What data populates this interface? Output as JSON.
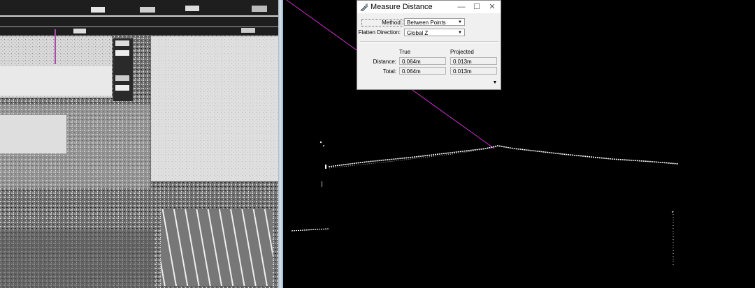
{
  "dialog": {
    "title": "Measure Distance",
    "method_label": "Method:",
    "method_value": "Between Points",
    "flatten_label": "Flatten Direction:",
    "flatten_value": "Global Z",
    "columns": {
      "true": "True",
      "projected": "Projected"
    },
    "distance_label": "Distance:",
    "total_label": "Total:",
    "distance": {
      "true": "0.064m",
      "projected": "0.013m"
    },
    "total": {
      "true": "0.064m",
      "projected": "0.013m"
    }
  },
  "icons": {
    "app": "measure-ruler-icon",
    "minimize": "minimize-icon",
    "maximize": "maximize-icon",
    "close": "close-icon",
    "expand": "expand-down-icon",
    "dropdown": "chevron-down-icon"
  },
  "colors": {
    "measure_line": "#cc33cc",
    "point_cloud": "#ffffff",
    "viewport_bg": "#000000",
    "splitter": "#c8d7e3"
  }
}
